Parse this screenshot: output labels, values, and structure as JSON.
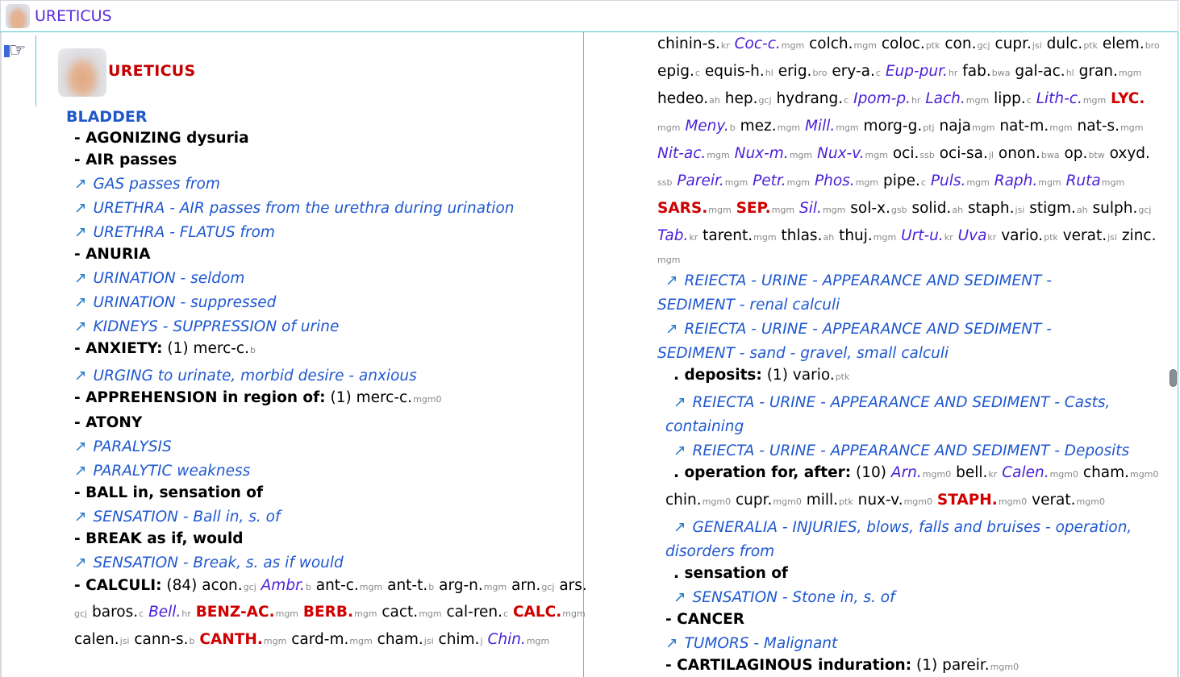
{
  "window": {
    "title": "URETICUS"
  },
  "remedy": {
    "title": "URETICUS",
    "section": "BLADDER"
  },
  "icons": {
    "hand": "pointing-hand-icon",
    "arrow": "↗"
  },
  "colors": {
    "accent": "#5b2bd8",
    "section": "#1f58c9",
    "xref": "#1f58d0",
    "bold_remedy": "#d00000",
    "italic_remedy": "#4a1fd8",
    "divider": "#50c8d6"
  },
  "left_lines": [
    {
      "type": "rub",
      "text": "- AGONIZING dysuria"
    },
    {
      "type": "rub",
      "text": "- AIR passes"
    },
    {
      "type": "xref",
      "text": "GAS passes from"
    },
    {
      "type": "xref",
      "text": "URETHRA - AIR passes from the urethra during urination"
    },
    {
      "type": "xref",
      "text": "URETHRA - FLATUS from"
    },
    {
      "type": "rub",
      "text": "- ANURIA"
    },
    {
      "type": "xref",
      "text": "URINATION - seldom"
    },
    {
      "type": "xref",
      "text": "URINATION - suppressed"
    },
    {
      "type": "xref",
      "text": "KIDNEYS - SUPPRESSION of urine"
    },
    {
      "type": "rub",
      "text": "- ANXIETY:",
      "tail": " (1) ",
      "remedies": [
        {
          "n": "merc-c.",
          "s": "b",
          "f": "plain"
        }
      ]
    },
    {
      "type": "xref",
      "text": "URGING to urinate, morbid desire - anxious"
    },
    {
      "type": "rub",
      "text": "- APPREHENSION in region of:",
      "tail": " (1) ",
      "remedies": [
        {
          "n": "merc-c.",
          "s": "mgm0",
          "f": "plain"
        }
      ]
    },
    {
      "type": "rub",
      "text": "- ATONY"
    },
    {
      "type": "xref",
      "text": "PARALYSIS"
    },
    {
      "type": "xref",
      "text": "PARALYTIC weakness"
    },
    {
      "type": "rub",
      "text": "- BALL in, sensation of"
    },
    {
      "type": "xref",
      "text": "SENSATION - Ball in, s. of"
    },
    {
      "type": "rub",
      "text": "- BREAK as if, would"
    },
    {
      "type": "xref",
      "text": "SENSATION - Break, s. as if would"
    },
    {
      "type": "rub",
      "text": "- CALCULI:",
      "tail": " (84) ",
      "remedies": [
        {
          "n": "acon.",
          "s": "gcj",
          "f": "plain"
        },
        {
          "n": "Ambr.",
          "s": "b",
          "f": "ital"
        },
        {
          "n": "ant-c.",
          "s": "mgm",
          "f": "plain"
        },
        {
          "n": "ant-t.",
          "s": "b",
          "f": "plain"
        },
        {
          "n": "arg-n.",
          "s": "mgm",
          "f": "plain"
        },
        {
          "n": "arn.",
          "s": "gcj",
          "f": "plain"
        },
        {
          "n": "ars.",
          "s": "",
          "f": "plain"
        }
      ]
    },
    {
      "type": "rems",
      "lead_sub": "gcj",
      "remedies": [
        {
          "n": "baros.",
          "s": "c",
          "f": "plain"
        },
        {
          "n": "Bell.",
          "s": "hr",
          "f": "ital"
        },
        {
          "n": "BENZ-AC.",
          "s": "mgm",
          "f": "bold"
        },
        {
          "n": "BERB.",
          "s": "mgm",
          "f": "bold"
        },
        {
          "n": "cact.",
          "s": "mgm",
          "f": "plain"
        },
        {
          "n": "cal-ren.",
          "s": "c",
          "f": "plain"
        },
        {
          "n": "CALC.",
          "s": "mgm",
          "f": "bold"
        }
      ]
    },
    {
      "type": "rems",
      "remedies": [
        {
          "n": "calen.",
          "s": "jsi",
          "f": "plain"
        },
        {
          "n": "cann-s.",
          "s": "b",
          "f": "plain"
        },
        {
          "n": "CANTH.",
          "s": "mgm",
          "f": "bold"
        },
        {
          "n": "card-m.",
          "s": "mgm",
          "f": "plain"
        },
        {
          "n": "cham.",
          "s": "jsi",
          "f": "plain"
        },
        {
          "n": "chim.",
          "s": "j",
          "f": "plain"
        },
        {
          "n": "Chin.",
          "s": "mgm",
          "f": "ital"
        }
      ]
    }
  ],
  "right_lines": [
    {
      "type": "rems",
      "remedies": [
        {
          "n": "chinin-s.",
          "s": "kr",
          "f": "plain"
        },
        {
          "n": "Coc-c.",
          "s": "mgm",
          "f": "ital"
        },
        {
          "n": "colch.",
          "s": "mgm",
          "f": "plain"
        },
        {
          "n": "coloc.",
          "s": "ptk",
          "f": "plain"
        },
        {
          "n": "con.",
          "s": "gcj",
          "f": "plain"
        },
        {
          "n": "cupr.",
          "s": "jsi",
          "f": "plain"
        },
        {
          "n": "dulc.",
          "s": "ptk",
          "f": "plain"
        },
        {
          "n": "elem.",
          "s": "bro",
          "f": "plain"
        }
      ]
    },
    {
      "type": "rems",
      "remedies": [
        {
          "n": "epig.",
          "s": "c",
          "f": "plain"
        },
        {
          "n": "equis-h.",
          "s": "hl",
          "f": "plain"
        },
        {
          "n": "erig.",
          "s": "bro",
          "f": "plain"
        },
        {
          "n": "ery-a.",
          "s": "c",
          "f": "plain"
        },
        {
          "n": "Eup-pur.",
          "s": "hr",
          "f": "ital"
        },
        {
          "n": "fab.",
          "s": "bwa",
          "f": "plain"
        },
        {
          "n": "gal-ac.",
          "s": "hl",
          "f": "plain"
        },
        {
          "n": "gran.",
          "s": "mgm",
          "f": "plain"
        }
      ]
    },
    {
      "type": "rems",
      "remedies": [
        {
          "n": "hedeo.",
          "s": "ah",
          "f": "plain"
        },
        {
          "n": "hep.",
          "s": "gcj",
          "f": "plain"
        },
        {
          "n": "hydrang.",
          "s": "c",
          "f": "plain"
        },
        {
          "n": "Ipom-p.",
          "s": "hr",
          "f": "ital"
        },
        {
          "n": "Lach.",
          "s": "mgm",
          "f": "ital"
        },
        {
          "n": "lipp.",
          "s": "c",
          "f": "plain"
        },
        {
          "n": "Lith-c.",
          "s": "mgm",
          "f": "ital"
        },
        {
          "n": "LYC.",
          "s": "",
          "f": "bold"
        }
      ]
    },
    {
      "type": "rems",
      "lead_sub": "mgm",
      "remedies": [
        {
          "n": "Meny.",
          "s": "b",
          "f": "ital"
        },
        {
          "n": "mez.",
          "s": "mgm",
          "f": "plain"
        },
        {
          "n": "Mill.",
          "s": "mgm",
          "f": "ital"
        },
        {
          "n": "morg-g.",
          "s": "ptj",
          "f": "plain"
        },
        {
          "n": "naja",
          "s": "mgm",
          "f": "plain"
        },
        {
          "n": "nat-m.",
          "s": "mgm",
          "f": "plain"
        },
        {
          "n": "nat-s.",
          "s": "mgm",
          "f": "plain"
        }
      ]
    },
    {
      "type": "rems",
      "remedies": [
        {
          "n": "Nit-ac.",
          "s": "mgm",
          "f": "ital"
        },
        {
          "n": "Nux-m.",
          "s": "mgm",
          "f": "ital"
        },
        {
          "n": "Nux-v.",
          "s": "mgm",
          "f": "ital"
        },
        {
          "n": "oci.",
          "s": "ssb",
          "f": "plain"
        },
        {
          "n": "oci-sa.",
          "s": "jl",
          "f": "plain"
        },
        {
          "n": "onon.",
          "s": "bwa",
          "f": "plain"
        },
        {
          "n": "op.",
          "s": "btw",
          "f": "plain"
        },
        {
          "n": "oxyd.",
          "s": "",
          "f": "plain"
        }
      ]
    },
    {
      "type": "rems",
      "lead_sub": "ssb",
      "remedies": [
        {
          "n": "Pareir.",
          "s": "mgm",
          "f": "ital"
        },
        {
          "n": "Petr.",
          "s": "mgm",
          "f": "ital"
        },
        {
          "n": "Phos.",
          "s": "mgm",
          "f": "ital"
        },
        {
          "n": "pipe.",
          "s": "c",
          "f": "plain"
        },
        {
          "n": "Puls.",
          "s": "mgm",
          "f": "ital"
        },
        {
          "n": "Raph.",
          "s": "mgm",
          "f": "ital"
        },
        {
          "n": "Ruta",
          "s": "mgm",
          "f": "ital"
        }
      ]
    },
    {
      "type": "rems",
      "remedies": [
        {
          "n": "SARS.",
          "s": "mgm",
          "f": "bold"
        },
        {
          "n": "SEP.",
          "s": "mgm",
          "f": "bold"
        },
        {
          "n": "Sil.",
          "s": "mgm",
          "f": "ital"
        },
        {
          "n": "sol-x.",
          "s": "gsb",
          "f": "plain"
        },
        {
          "n": "solid.",
          "s": "ah",
          "f": "plain"
        },
        {
          "n": "staph.",
          "s": "jsi",
          "f": "plain"
        },
        {
          "n": "stigm.",
          "s": "ah",
          "f": "plain"
        },
        {
          "n": "sulph.",
          "s": "gcj",
          "f": "plain"
        }
      ]
    },
    {
      "type": "rems",
      "remedies": [
        {
          "n": "Tab.",
          "s": "kr",
          "f": "ital"
        },
        {
          "n": "tarent.",
          "s": "mgm",
          "f": "plain"
        },
        {
          "n": "thlas.",
          "s": "ah",
          "f": "plain"
        },
        {
          "n": "thuj.",
          "s": "mgm",
          "f": "plain"
        },
        {
          "n": "Urt-u.",
          "s": "kr",
          "f": "ital"
        },
        {
          "n": "Uva",
          "s": "kr",
          "f": "ital"
        },
        {
          "n": "vario.",
          "s": "ptk",
          "f": "plain"
        },
        {
          "n": "verat.",
          "s": "jsi",
          "f": "plain"
        },
        {
          "n": "zinc.",
          "s": "",
          "f": "plain"
        }
      ]
    },
    {
      "type": "lone_sub",
      "text": "mgm"
    },
    {
      "type": "xref",
      "text": "REIECTA - URINE - APPEARANCE AND SEDIMENT -"
    },
    {
      "type": "xref_cont",
      "text": "SEDIMENT - renal calculi"
    },
    {
      "type": "xref",
      "text": "REIECTA - URINE - APPEARANCE AND SEDIMENT -"
    },
    {
      "type": "xref_cont",
      "text": "SEDIMENT - sand - gravel, small calculi"
    },
    {
      "type": "rub",
      "indent": 10,
      "text": ". deposits:",
      "tail": " (1) ",
      "remedies": [
        {
          "n": "vario.",
          "s": "ptk",
          "f": "plain"
        }
      ]
    },
    {
      "type": "xref",
      "indent": 10,
      "text": "REIECTA - URINE - APPEARANCE AND SEDIMENT - Casts,"
    },
    {
      "type": "xref_cont",
      "indent": 10,
      "text": "containing"
    },
    {
      "type": "xref",
      "indent": 10,
      "text": "REIECTA - URINE - APPEARANCE AND SEDIMENT - Deposits"
    },
    {
      "type": "rub",
      "indent": 10,
      "text": ". operation for, after:",
      "tail": " (10) ",
      "remedies": [
        {
          "n": "Arn.",
          "s": "mgm0",
          "f": "ital"
        },
        {
          "n": "bell.",
          "s": "kr",
          "f": "plain"
        },
        {
          "n": "Calen.",
          "s": "mgm0",
          "f": "ital"
        },
        {
          "n": "cham.",
          "s": "mgm0",
          "f": "plain"
        }
      ]
    },
    {
      "type": "rems",
      "indent": 10,
      "remedies": [
        {
          "n": "chin.",
          "s": "mgm0",
          "f": "plain"
        },
        {
          "n": "cupr.",
          "s": "mgm0",
          "f": "plain"
        },
        {
          "n": "mill.",
          "s": "ptk",
          "f": "plain"
        },
        {
          "n": "nux-v.",
          "s": "mgm0",
          "f": "plain"
        },
        {
          "n": "STAPH.",
          "s": "mgm0",
          "f": "bold"
        },
        {
          "n": "verat.",
          "s": "mgm0",
          "f": "plain"
        }
      ]
    },
    {
      "type": "xref",
      "indent": 10,
      "text": "GENERALIA - INJURIES, blows, falls and bruises - operation,"
    },
    {
      "type": "xref_cont",
      "indent": 10,
      "text": "disorders from"
    },
    {
      "type": "rub",
      "indent": 10,
      "text": ". sensation of"
    },
    {
      "type": "xref",
      "indent": 10,
      "text": "SENSATION - Stone in, s. of"
    },
    {
      "type": "rub",
      "text": "- CANCER"
    },
    {
      "type": "xref",
      "text": "TUMORS - Malignant"
    },
    {
      "type": "rub",
      "text": "- CARTILAGINOUS induration:",
      "tail": " (1) ",
      "remedies": [
        {
          "n": "pareir.",
          "s": "mgm0",
          "f": "plain"
        }
      ]
    }
  ]
}
